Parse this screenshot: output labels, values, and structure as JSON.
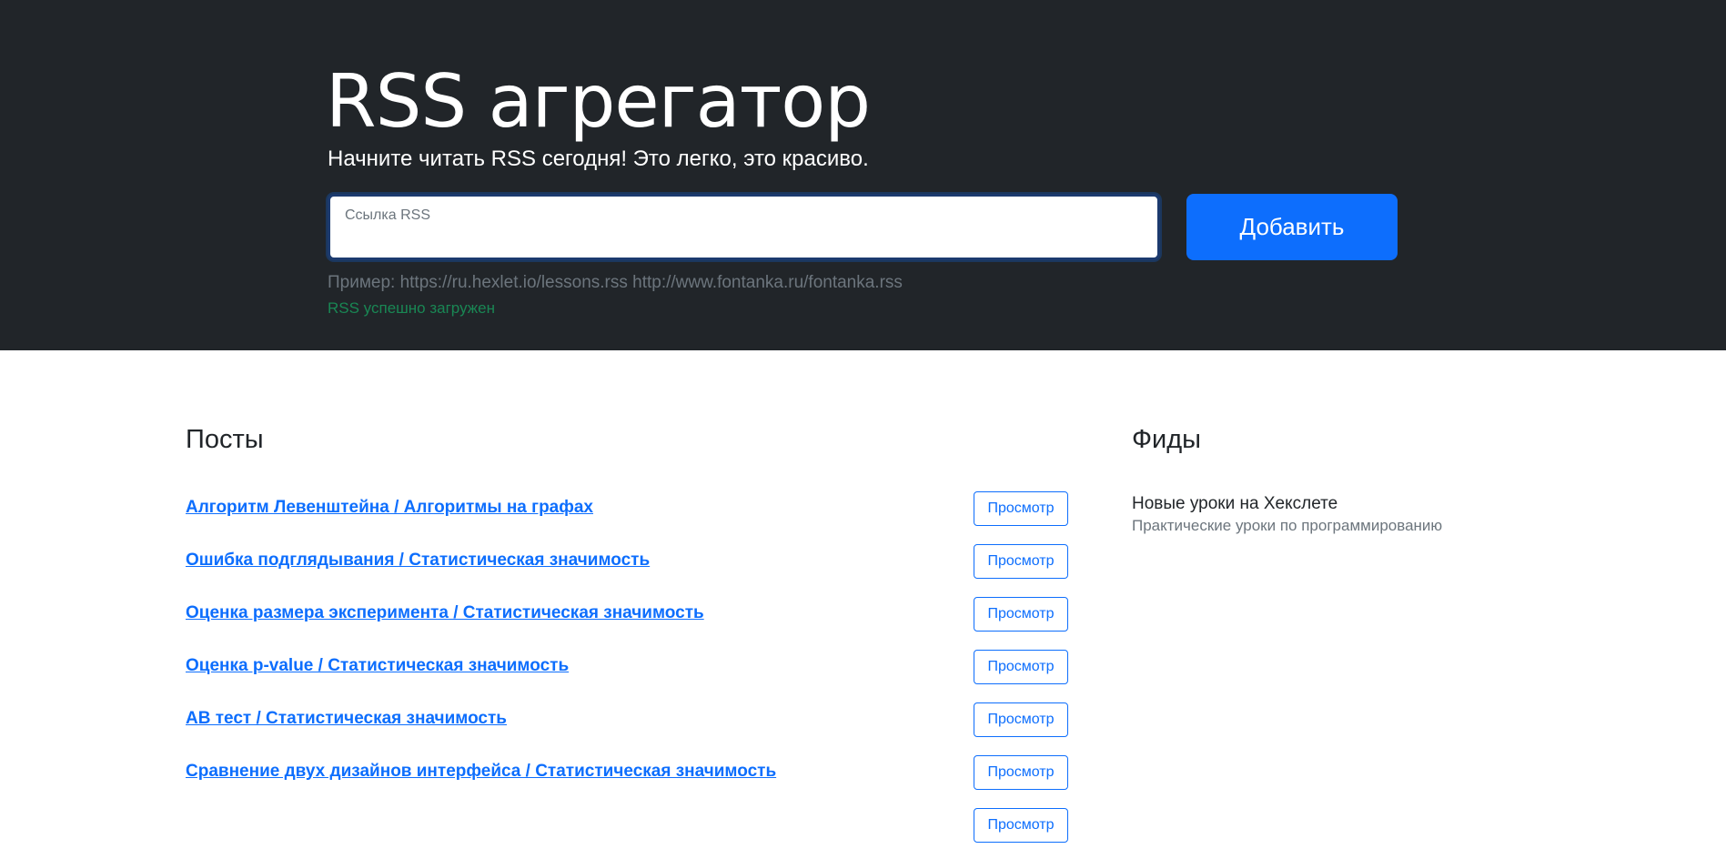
{
  "hero": {
    "title": "RSS агрегатор",
    "lead": "Начните читать RSS сегодня! Это легко, это красиво.",
    "input_placeholder": "Ссылка RSS",
    "add_button": "Добавить",
    "example": "Пример: https://ru.hexlet.io/lessons.rss http://www.fontanka.ru/fontanka.rss",
    "feedback": "RSS успешно загружен"
  },
  "posts": {
    "title": "Посты",
    "view_label": "Просмотр",
    "items": [
      {
        "title": "Алгоритм Левенштейна / Алгоритмы на графах"
      },
      {
        "title": "Ошибка подглядывания / Статистическая значимость"
      },
      {
        "title": "Оценка размера эксперимента / Статистическая значимость"
      },
      {
        "title": "Оценка p-value / Статистическая значимость"
      },
      {
        "title": "AB тест / Статистическая значимость"
      },
      {
        "title": "Сравнение двух дизайнов интерфейса / Статистическая значимость"
      },
      {
        "title": ""
      }
    ]
  },
  "feeds": {
    "title": "Фиды",
    "items": [
      {
        "name": "Новые уроки на Хекслете",
        "description": "Практические уроки по программированию"
      }
    ]
  },
  "colors": {
    "hero_bg": "#212529",
    "primary": "#0d6efd",
    "success": "#198754",
    "muted": "#6c757d"
  }
}
